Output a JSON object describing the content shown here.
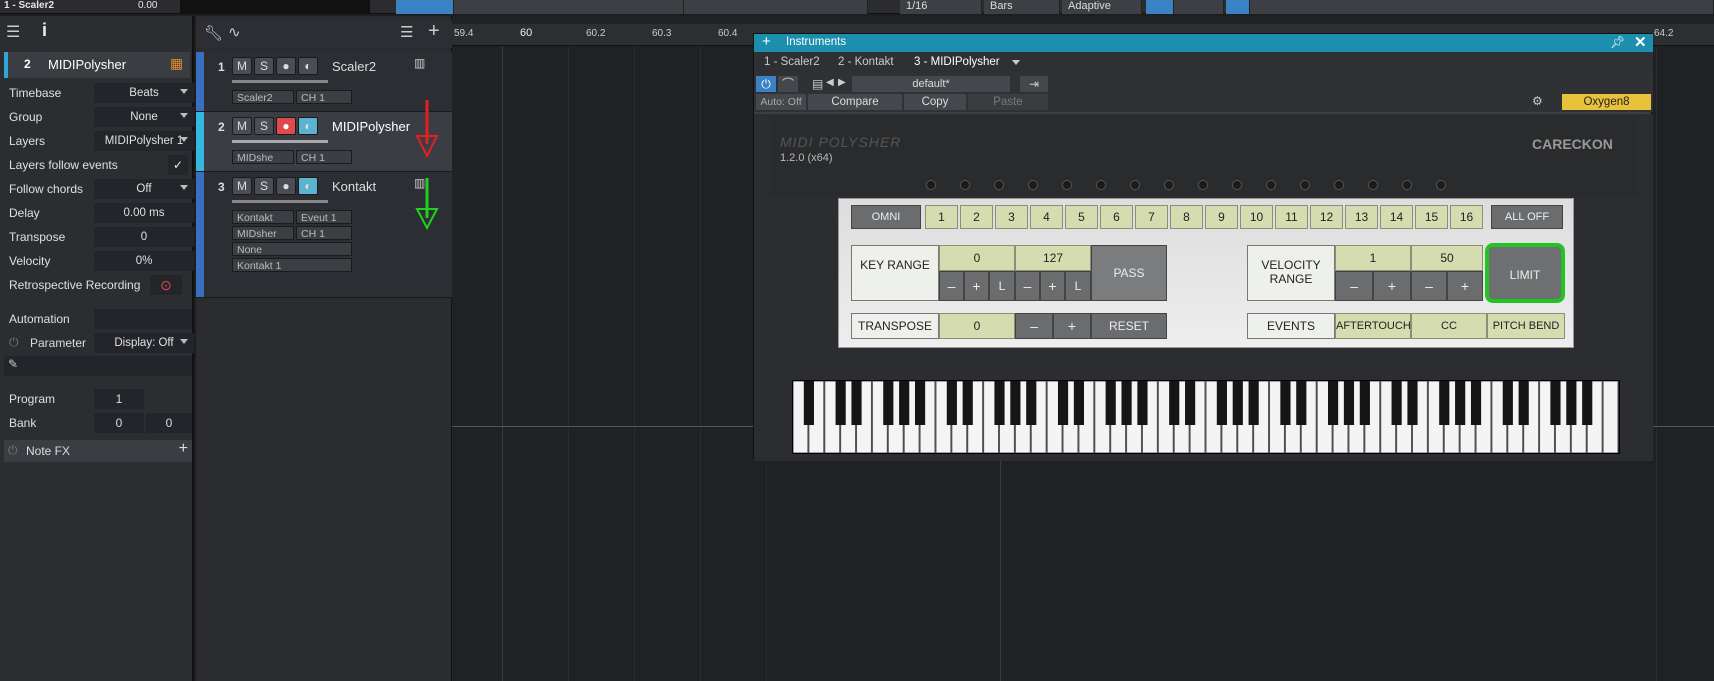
{
  "top": {
    "song_title": "1 - Scaler2",
    "value": "0.00",
    "quantize": "1/16",
    "timebase": "Bars",
    "snap": "Adaptive"
  },
  "inspector": {
    "track_num": "2",
    "track_name": "MIDIPolysher",
    "rows": [
      {
        "label": "Timebase",
        "value": "Beats"
      },
      {
        "label": "Group",
        "value": "None"
      },
      {
        "label": "Layers",
        "value": "MIDIPolysher 1"
      },
      {
        "label": "Layers follow events",
        "value": ""
      },
      {
        "label": "Follow chords",
        "value": "Off"
      },
      {
        "label": "Delay",
        "value": "0.00 ms"
      },
      {
        "label": "Transpose",
        "value": "0"
      },
      {
        "label": "Velocity",
        "value": "0%"
      },
      {
        "label": "Retrospective Recording",
        "value": ""
      }
    ],
    "automation": "Automation",
    "parameter": "Parameter",
    "display": "Display: Off",
    "program_label": "Program",
    "program_val": "1",
    "bank_label": "Bank",
    "bank_val1": "0",
    "bank_val2": "0",
    "notefx": "Note FX"
  },
  "tracks": [
    {
      "num": "1",
      "name": "Scaler2",
      "input": "Scaler2",
      "channel": "CH 1"
    },
    {
      "num": "2",
      "name": "MIDIPolysher",
      "input": "MIDshe",
      "channel": "CH 1"
    },
    {
      "num": "3",
      "name": "Kontakt",
      "input": "Kontakt",
      "channel": "Eveut 1",
      "input2": "MIDsher",
      "channel2": "CH 1",
      "row3": "None",
      "row4": "Kontakt 1"
    }
  ],
  "buttons": {
    "m": "M",
    "s": "S"
  },
  "ruler": [
    "59.4",
    "60",
    "60.2",
    "60.3",
    "60.4",
    "64.2"
  ],
  "plugin": {
    "window_title": "Instruments",
    "tabs": [
      "1 - Scaler2",
      "2 - Kontakt",
      "3 - MIDIPolysher"
    ],
    "preset": "default*",
    "auto": "Auto: Off",
    "compare": "Compare",
    "copy": "Copy",
    "paste": "Paste",
    "device": "Oxygen8",
    "brand": "MIDI POLYSHER",
    "version": "1.2.0 (x64)",
    "maker": "CARECKON",
    "omni": "OMNI",
    "channels": [
      "1",
      "2",
      "3",
      "4",
      "5",
      "6",
      "7",
      "8",
      "9",
      "10",
      "11",
      "12",
      "13",
      "14",
      "15",
      "16"
    ],
    "alloff": "ALL OFF",
    "key_range": "KEY RANGE",
    "key_lo": "0",
    "key_hi": "127",
    "pass": "PASS",
    "vel_range": "VELOCITY RANGE",
    "vel_lo": "1",
    "vel_hi": "50",
    "limit": "LIMIT",
    "minus": "–",
    "plus": "+",
    "L": "L",
    "transpose": "TRANSPOSE",
    "transpose_val": "0",
    "reset": "RESET",
    "events": "EVENTS",
    "aftertouch": "AFTERTOUCH",
    "cc": "CC",
    "pitchbend": "PITCH BEND"
  },
  "colors": {
    "accent": "#1c8fae",
    "rec": "#e04a4a",
    "arrow_red": "#e32020",
    "arrow_green": "#1fd01f",
    "highlight": "#22c322"
  }
}
